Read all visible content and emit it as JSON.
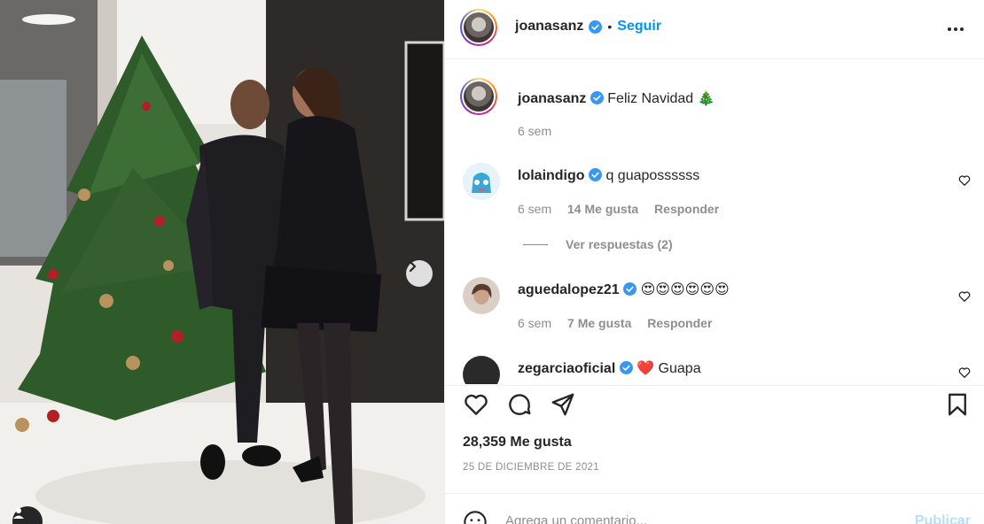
{
  "post": {
    "author": "joanasanz",
    "follow_label": "Seguir",
    "separator": "•",
    "caption": "Feliz Navidad 🎄",
    "caption_age": "6 sem"
  },
  "comments": [
    {
      "user": "lolaindigo",
      "text": "q guapossssss",
      "age": "6 sem",
      "likes": "14 Me gusta",
      "reply_label": "Responder"
    },
    {
      "user": "aguedalopez21",
      "text": "😍😍😍😍😍😍",
      "age": "6 sem",
      "likes": "7 Me gusta",
      "reply_label": "Responder"
    },
    {
      "user": "zegarciaoficial",
      "text": "❤️ Guapa"
    }
  ],
  "view_replies": "Ver respuestas (2)",
  "stats": {
    "likes": "28,359 Me gusta",
    "date": "25 DE DICIEMBRE DE 2021"
  },
  "composer": {
    "placeholder": "Agrega un comentario...",
    "publish_label": "Publicar"
  },
  "colors": {
    "accent": "#0095f6",
    "verified": "#3897f0",
    "publish_disabled": "#b2dffc",
    "muted": "#8e8e8e"
  },
  "icons": [
    "more-icon",
    "heart-icon",
    "comment-icon",
    "share-icon",
    "bookmark-icon",
    "emoji-icon",
    "chevron-right-icon",
    "tag-user-icon",
    "verified-badge-icon"
  ]
}
